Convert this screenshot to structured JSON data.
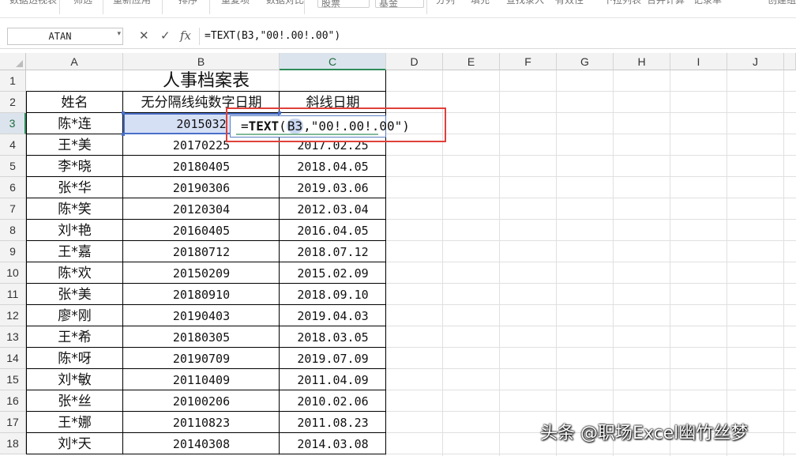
{
  "ribbon": {
    "items": [
      "数据透视表",
      "筛选",
      "重新应用",
      "排序",
      "重复项",
      "数据对比",
      "股票",
      "基金",
      "分列",
      "填充",
      "查找录入",
      "有效性",
      "下拉列表",
      "合并计算",
      "记录单",
      "创建组"
    ]
  },
  "formula_bar": {
    "name_box": "ATAN",
    "cancel_icon": "✕",
    "confirm_icon": "✓",
    "fx_label": "fx",
    "formula": "=TEXT(B3,\"00!.00!.00\")"
  },
  "columns": [
    "A",
    "B",
    "C",
    "D",
    "E",
    "F",
    "G",
    "H",
    "I",
    "J"
  ],
  "rows": [
    "1",
    "2",
    "3",
    "4",
    "5",
    "6",
    "7",
    "8",
    "9",
    "10",
    "11",
    "12",
    "13",
    "14",
    "15",
    "16",
    "17",
    "18"
  ],
  "table": {
    "title": "人事档案表",
    "headers": [
      "姓名",
      "无分隔线纯数字日期",
      "斜线日期"
    ],
    "records": [
      {
        "name": "陈*连",
        "num": "2015032",
        "date": ""
      },
      {
        "name": "王*美",
        "num": "20170225",
        "date": "2017.02.25"
      },
      {
        "name": "李*晓",
        "num": "20180405",
        "date": "2018.04.05"
      },
      {
        "name": "张*华",
        "num": "20190306",
        "date": "2019.03.06"
      },
      {
        "name": "陈*笑",
        "num": "20120304",
        "date": "2012.03.04"
      },
      {
        "name": "刘*艳",
        "num": "20160405",
        "date": "2016.04.05"
      },
      {
        "name": "王*嘉",
        "num": "20180712",
        "date": "2018.07.12"
      },
      {
        "name": "陈*欢",
        "num": "20150209",
        "date": "2015.02.09"
      },
      {
        "name": "张*美",
        "num": "20180910",
        "date": "2018.09.10"
      },
      {
        "name": "廖*刚",
        "num": "20190403",
        "date": "2019.04.03"
      },
      {
        "name": "王*希",
        "num": "20180305",
        "date": "2018.03.05"
      },
      {
        "name": "陈*呀",
        "num": "20190709",
        "date": "2019.07.09"
      },
      {
        "name": "刘*敏",
        "num": "20110409",
        "date": "2011.04.09"
      },
      {
        "name": "张*丝",
        "num": "20100206",
        "date": "2010.02.06"
      },
      {
        "name": "王*娜",
        "num": "20110823",
        "date": "2011.08.23"
      },
      {
        "name": "刘*天",
        "num": "20140308",
        "date": "2014.03.08"
      }
    ]
  },
  "active_cell": "C3",
  "edit": {
    "prefix": "=",
    "func": "TEXT",
    "open": "(",
    "ref": "B3",
    "rest": ",\"00!.00!.00\")"
  },
  "watermark": "头条 @职场Excel幽竹丝梦",
  "colors": {
    "selection": "#4a6fc9",
    "callout": "#e0403a",
    "active_header": "#2e8b57"
  }
}
